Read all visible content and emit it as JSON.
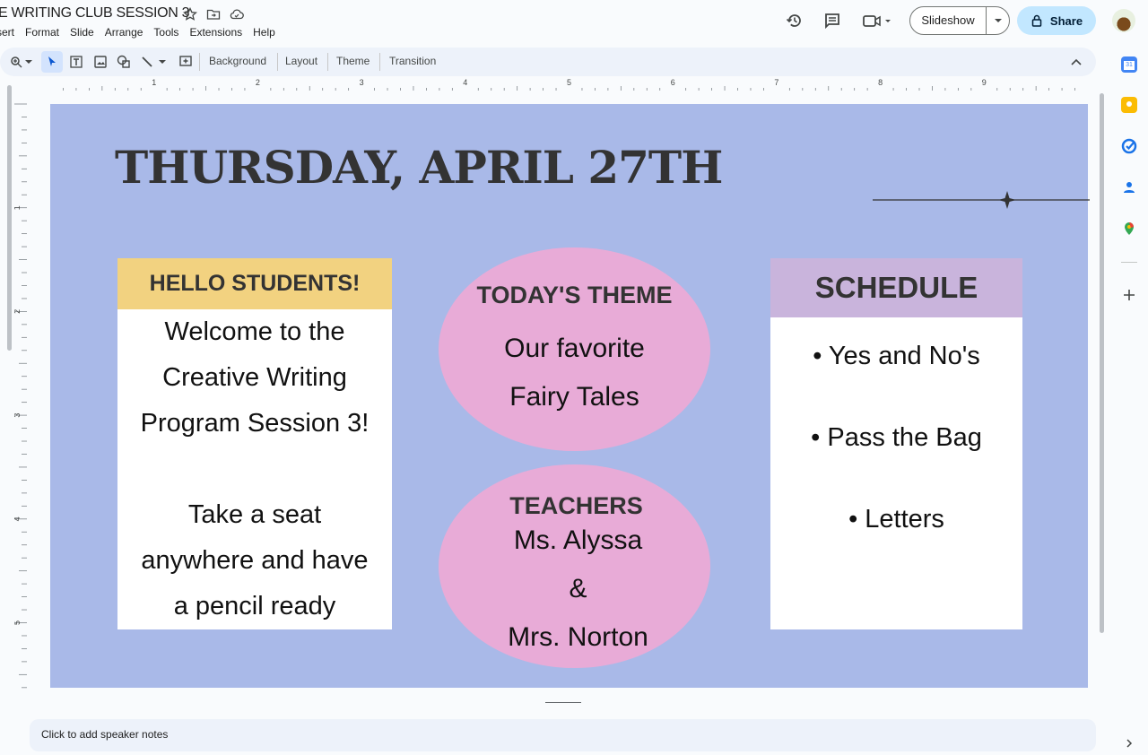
{
  "app": {
    "doc_title": "E WRITING CLUB SESSION 3",
    "menu": [
      "sert",
      "Format",
      "Slide",
      "Arrange",
      "Tools",
      "Extensions",
      "Help"
    ],
    "slideshow_label": "Slideshow",
    "share_label": "Share"
  },
  "toolbar": {
    "background": "Background",
    "layout": "Layout",
    "theme": "Theme",
    "transition": "Transition"
  },
  "ruler": {
    "h_ticks": [
      "1",
      "2",
      "3",
      "4",
      "5",
      "6",
      "7",
      "8",
      "9"
    ],
    "v_ticks": [
      "1",
      "2",
      "3",
      "4",
      "5"
    ]
  },
  "slide": {
    "title": "THURSDAY, APRIL 27TH",
    "hello": {
      "header": "HELLO STUDENTS!",
      "lines": [
        "Welcome to the",
        "Creative Writing",
        "Program Session 3!",
        "",
        "Take a seat",
        "anywhere and have",
        "a pencil ready"
      ]
    },
    "theme": {
      "header": "TODAY'S THEME",
      "lines": [
        "Our favorite",
        "Fairy Tales"
      ]
    },
    "teachers": {
      "header": "TEACHERS",
      "lines": [
        "Ms. Alyssa",
        "&",
        "Mrs. Norton"
      ]
    },
    "schedule": {
      "header": "SCHEDULE",
      "items": [
        "• Yes and No's",
        "• Pass the Bag",
        "• Letters"
      ]
    },
    "colors": {
      "background": "#a9b9e8",
      "hello_header": "#f2d280",
      "schedule_header": "#c9b4dc",
      "ellipse": "#e8abd7"
    }
  },
  "notes": {
    "placeholder": "Click to add speaker notes"
  }
}
